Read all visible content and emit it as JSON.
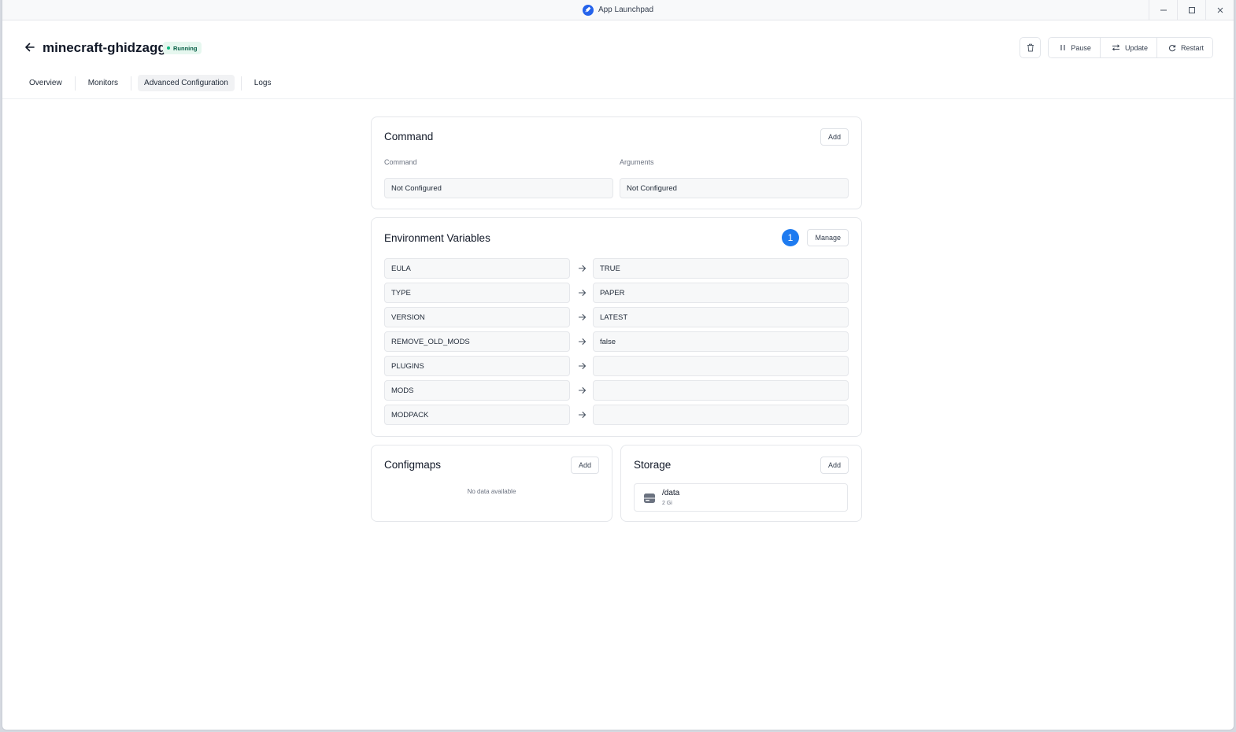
{
  "window": {
    "title": "App Launchpad"
  },
  "header": {
    "app_name": "minecraft-ghidzagg",
    "status": "Running",
    "actions": {
      "pause": "Pause",
      "update": "Update",
      "restart": "Restart"
    }
  },
  "tabs": [
    {
      "label": "Overview"
    },
    {
      "label": "Monitors"
    },
    {
      "label": "Advanced Configuration"
    },
    {
      "label": "Logs"
    }
  ],
  "command": {
    "title": "Command",
    "add_label": "Add",
    "command_label": "Command",
    "command_value": "Not Configured",
    "arguments_label": "Arguments",
    "arguments_value": "Not Configured"
  },
  "env": {
    "title": "Environment Variables",
    "count": "1",
    "manage_label": "Manage",
    "vars": [
      {
        "key": "EULA",
        "value": "TRUE"
      },
      {
        "key": "TYPE",
        "value": "PAPER"
      },
      {
        "key": "VERSION",
        "value": "LATEST"
      },
      {
        "key": "REMOVE_OLD_MODS",
        "value": "false"
      },
      {
        "key": "PLUGINS",
        "value": ""
      },
      {
        "key": "MODS",
        "value": ""
      },
      {
        "key": "MODPACK",
        "value": ""
      }
    ]
  },
  "configmaps": {
    "title": "Configmaps",
    "add_label": "Add",
    "empty_text": "No data available"
  },
  "storage": {
    "title": "Storage",
    "add_label": "Add",
    "items": [
      {
        "path": "/data",
        "size": "2 Gi"
      }
    ]
  },
  "colors": {
    "accent": "#1e7bf0",
    "status": "#10b981"
  }
}
